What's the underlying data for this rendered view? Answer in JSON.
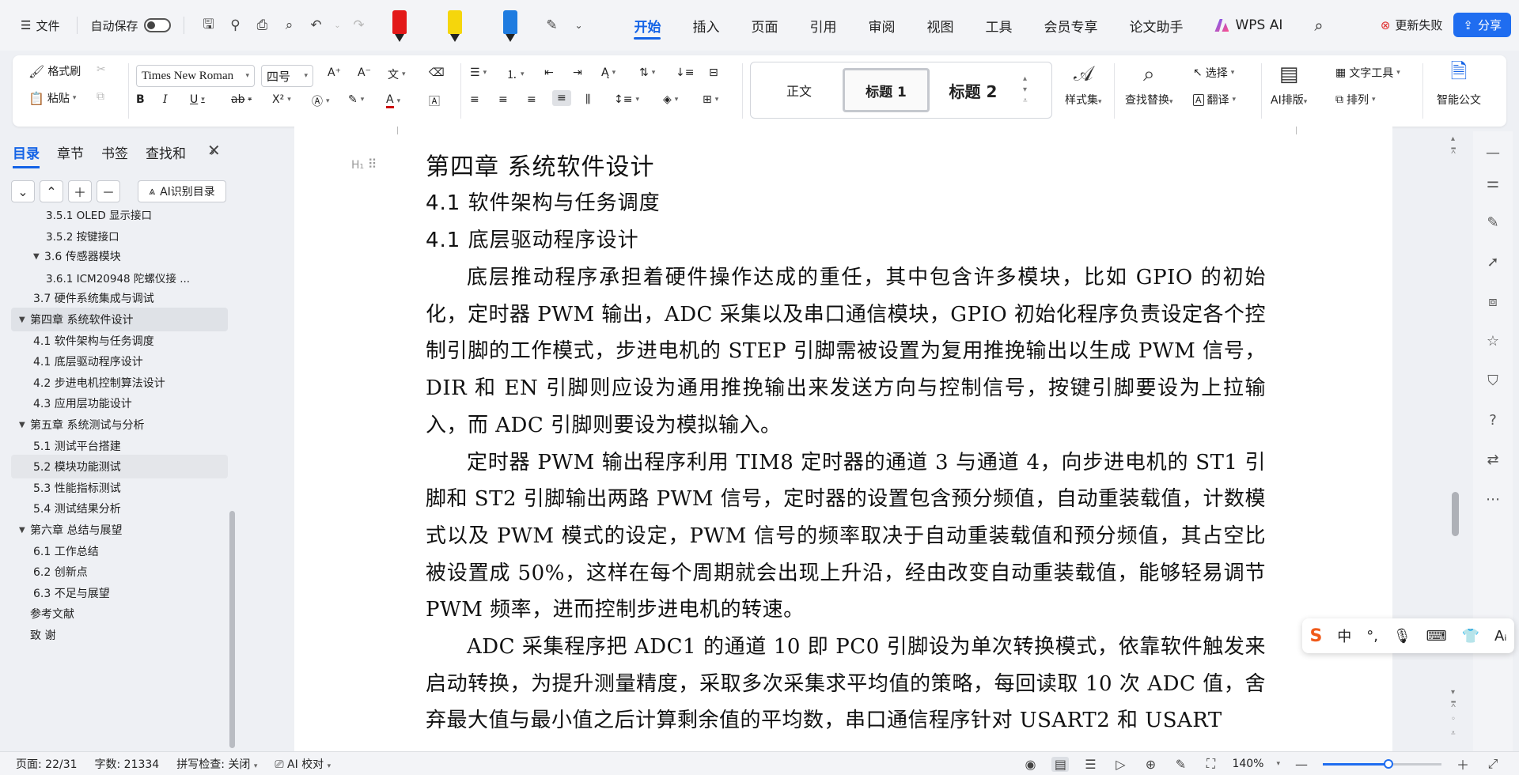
{
  "menubar": {
    "file_label": "文件",
    "autosave_label": "自动保存",
    "autosave_on": false,
    "pen_colors": [
      "#e31919",
      "#f5d60c",
      "#1f7ce0"
    ],
    "tabs": [
      {
        "label": "开始",
        "active": true
      },
      {
        "label": "插入"
      },
      {
        "label": "页面"
      },
      {
        "label": "引用"
      },
      {
        "label": "审阅"
      },
      {
        "label": "视图"
      },
      {
        "label": "工具"
      },
      {
        "label": "会员专享"
      },
      {
        "label": "论文助手"
      }
    ],
    "wps_ai_label": "WPS AI",
    "update_label": "更新失败",
    "share_label": "分享",
    "accent_color": "#1463e6"
  },
  "ribbon": {
    "format_painter": "格式刷",
    "paste": "粘贴",
    "font_name": "Times New Roman",
    "font_size": "四号",
    "style_normal": "正文",
    "style_h1": "标题 1",
    "style_h2": "标题 2",
    "style_set": "样式集",
    "find_replace": "查找替换",
    "select": "选择",
    "translate": "翻译",
    "text_tools": "文字工具",
    "ai_layout": "AI排版",
    "arrange": "排列",
    "smart_doc": "智能公文"
  },
  "left_panel": {
    "tabs": [
      {
        "label": "目录",
        "active": true
      },
      {
        "label": "章节"
      },
      {
        "label": "书签"
      },
      {
        "label": "查找和"
      }
    ],
    "ai_toc_label": "AI识别目录",
    "toc": [
      {
        "label": "3.5.1 OLED 显示接口",
        "level": 3
      },
      {
        "label": "3.5.2 按键接口",
        "level": 3
      },
      {
        "label": "3.6 传感器模块",
        "level": 2,
        "expanded": true
      },
      {
        "label": "3.6.1 ICM20948 陀螺仪接 ...",
        "level": 3
      },
      {
        "label": "3.7 硬件系统集成与调试",
        "level": 2
      },
      {
        "label": "第四章 系统软件设计",
        "level": 1,
        "expanded": true,
        "selected": true
      },
      {
        "label": "4.1 软件架构与任务调度",
        "level": 2
      },
      {
        "label": "4.1 底层驱动程序设计",
        "level": 2
      },
      {
        "label": "4.2 步进电机控制算法设计",
        "level": 2
      },
      {
        "label": "4.3 应用层功能设计",
        "level": 2
      },
      {
        "label": "第五章 系统测试与分析",
        "level": 1,
        "expanded": true
      },
      {
        "label": "5.1 测试平台搭建",
        "level": 2
      },
      {
        "label": "5.2 模块功能测试",
        "level": 2,
        "hover": true
      },
      {
        "label": "5.3 性能指标测试",
        "level": 2
      },
      {
        "label": "5.4 测试结果分析",
        "level": 2
      },
      {
        "label": "第六章 总结与展望",
        "level": 1,
        "expanded": true
      },
      {
        "label": "6.1 工作总结",
        "level": 2
      },
      {
        "label": "6.2 创新点",
        "level": 2
      },
      {
        "label": "6.3 不足与展望",
        "level": 2
      },
      {
        "label": "参考文献",
        "level": 1
      },
      {
        "label": "致  谢",
        "level": 1
      }
    ]
  },
  "document": {
    "heading_mark": "H₁",
    "chapter_title": "第四章  系统软件设计",
    "section1": "4.1  软件架构与任务调度",
    "section2": "4.1  底层驱动程序设计",
    "para1": "底层推动程序承担着硬件操作达成的重任，其中包含许多模块，比如 GPIO 的初始化，定时器 PWM 输出，ADC 采集以及串口通信模块，GPIO 初始化程序负责设定各个控制引脚的工作模式，步进电机的 STEP 引脚需被设置为复用推挽输出以生成 PWM 信号，DIR 和 EN 引脚则应设为通用推挽输出来发送方向与控制信号，按键引脚要设为上拉输入，而 ADC 引脚则要设为模拟输入。",
    "para2": "定时器 PWM 输出程序利用 TIM8 定时器的通道 3 与通道 4，向步进电机的 ST1 引脚和 ST2 引脚输出两路 PWM 信号，定时器的设置包含预分频值，自动重装载值，计数模式以及 PWM 模式的设定，PWM 信号的频率取决于自动重装载值和预分频值，其占空比被设置成 50%，这样在每个周期就会出现上升沿，经由改变自动重装载值，能够轻易调节 PWM 频率，进而控制步进电机的转速。",
    "para3": "ADC 采集程序把 ADC1 的通道 10 即 PC0 引脚设为单次转换模式，依靠软件触发来启动转换，为提升测量精度，采取多次采集求平均值的策略，每回读取 10 次 ADC 值，舍弃最大值与最小值之后计算剩余值的平均数，串口通信程序针对 USART2 和 USART"
  },
  "status_bar": {
    "page": "页面: 22/31",
    "word_count": "字数: 21334",
    "spell_check": "拼写检查: 关闭",
    "ai_proofread": "AI 校对",
    "zoom": "140%",
    "zoom_fraction": 0.55
  }
}
